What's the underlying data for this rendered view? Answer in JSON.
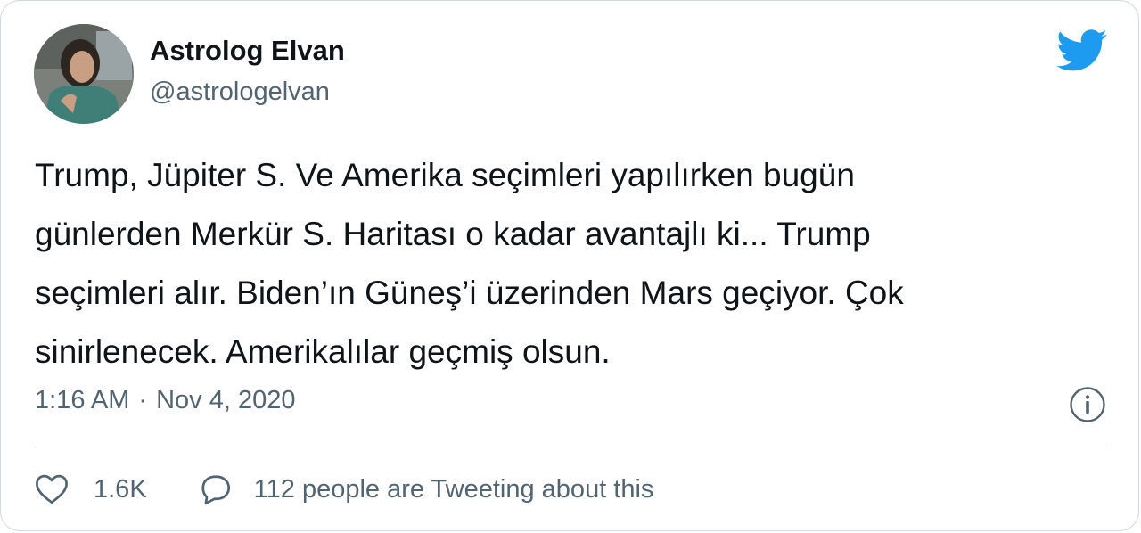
{
  "author": {
    "name": "Astrolog Elvan",
    "handle": "@astrologelvan"
  },
  "tweet": {
    "text": "Trump, Jüpiter S. Ve Amerika seçimleri yapılırken bugün\ngünlerden Merkür S. Haritası o kadar avantajlı ki... Trump\nseçimleri alır. Biden’ın Güneş’i üzerinden Mars geçiyor. Çok\nsinirlenecek. Amerikalılar geçmiş olsun.",
    "time": "1:16 AM",
    "separator": "·",
    "date": "Nov 4, 2020"
  },
  "actions": {
    "likes": "1.6K",
    "conversation": "112 people are Tweeting about this"
  },
  "icons": {
    "brand": "twitter-bird-icon",
    "info": "info-icon",
    "like": "heart-icon",
    "reply": "speech-bubble-icon"
  },
  "colors": {
    "brand": "#1d9bf0",
    "text": "#0f1419",
    "secondary": "#536471",
    "border": "#cfd9de"
  }
}
